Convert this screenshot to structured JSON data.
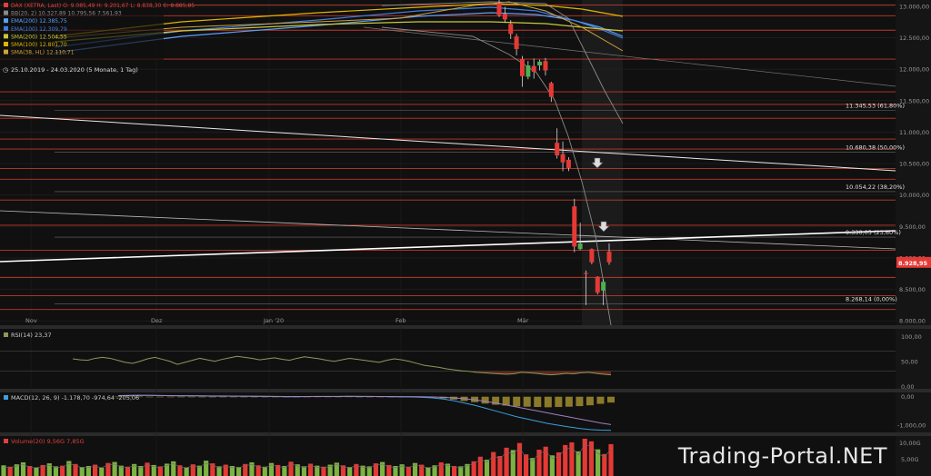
{
  "watermark": "Trading-Portal.NET",
  "main_legend": [
    {
      "text": "DAX (XETRA, Last)  O: 9.085,49  H: 9.201,67  L: 8.838,30  C: 8.885,85",
      "color": "#e04040"
    },
    {
      "text": "BB(20, 2)  10.327,89  10.795,56  7.561,93",
      "color": "#8a8a8a"
    },
    {
      "text": "EMA(200)  12.385,75",
      "color": "#5aa0ff"
    },
    {
      "text": "EMA(100)  12.309,79",
      "color": "#3f7de0"
    },
    {
      "text": "SMA(200)  12.504,55",
      "color": "#c9c93a"
    },
    {
      "text": "SMA(100)  12.801,70",
      "color": "#e0b400"
    },
    {
      "text": "SMA(38, HL)  12.110,71",
      "color": "#d2a23a"
    }
  ],
  "period_label": "25.10.2019 - 24.03.2020  (5 Monate, 1 Tag)",
  "rsi_legend": "RSI(14)  23,37",
  "macd_legend": "MACD(12, 26, 9)  -1.178,70  -974,64  -205,06",
  "volume_legend": "Volume(20)  9,56G  7,85G",
  "current_price_badge": "8.928,95",
  "colors": {
    "up": "#4caf50",
    "down": "#e53935",
    "level_line": "#c0392b",
    "trend_line": "#e8e8e8",
    "bg": "#101010"
  },
  "chart_data": [
    {
      "type": "candlestick",
      "title": "DAX (XETRA, Last)",
      "x_tick_labels": [
        "Nov",
        "Dez",
        "Jan '20",
        "Feb",
        "Mär"
      ],
      "y_tick_labels": [
        "13.000,00",
        "12.500,00",
        "12.000,00",
        "11.500,00",
        "11.000,00",
        "10.500,00",
        "10.000,00",
        "9.500,00",
        "9.000,00",
        "8.500,00",
        "8.000,00"
      ],
      "ylim": [
        7930,
        13100
      ],
      "fibonacci": [
        {
          "value": 11345.53,
          "label": "11.345,53 (61,80%)"
        },
        {
          "value": 10680.38,
          "label": "10.680,38 (50,00%)"
        },
        {
          "value": 10054.22,
          "label": "10.054,22 (38,20%)"
        },
        {
          "value": 9330.05,
          "label": "9.330,05 (23,60%)"
        },
        {
          "value": 8268.14,
          "label": "8.268,14 (0,00%)"
        }
      ],
      "horizontal_levels": [
        13020,
        12850,
        12620,
        12160,
        11640,
        11440,
        11220,
        10890,
        10730,
        10420,
        10250,
        9920,
        9520,
        9120,
        8690,
        8400,
        8180
      ],
      "last_price": 8928.95,
      "candles": [
        {
          "date": "24.02.2020",
          "open": 13050,
          "high": 13150,
          "low": 12830,
          "close": 12860
        },
        {
          "date": "25.02.2020",
          "open": 12880,
          "high": 12990,
          "low": 12740,
          "close": 12790
        },
        {
          "date": "26.02.2020",
          "open": 12720,
          "high": 12780,
          "low": 12480,
          "close": 12560
        },
        {
          "date": "27.02.2020",
          "open": 12520,
          "high": 12560,
          "low": 12220,
          "close": 12320
        },
        {
          "date": "28.02.2020",
          "open": 12160,
          "high": 12210,
          "low": 11720,
          "close": 11890
        },
        {
          "date": "02.03.2020",
          "open": 11880,
          "high": 12130,
          "low": 11840,
          "close": 12060
        },
        {
          "date": "03.03.2020",
          "open": 12050,
          "high": 12170,
          "low": 11850,
          "close": 11960
        },
        {
          "date": "04.03.2020",
          "open": 12060,
          "high": 12150,
          "low": 11980,
          "close": 12120
        },
        {
          "date": "05.03.2020",
          "open": 12130,
          "high": 12180,
          "low": 11900,
          "close": 11980
        },
        {
          "date": "06.03.2020",
          "open": 11780,
          "high": 11800,
          "low": 11480,
          "close": 11560
        },
        {
          "date": "09.03.2020",
          "open": 10830,
          "high": 11060,
          "low": 10580,
          "close": 10630
        },
        {
          "date": "10.03.2020",
          "open": 10650,
          "high": 10850,
          "low": 10380,
          "close": 10520
        },
        {
          "date": "11.03.2020",
          "open": 10560,
          "high": 10600,
          "low": 10380,
          "close": 10430
        },
        {
          "date": "12.03.2020",
          "open": 9820,
          "high": 9940,
          "low": 9090,
          "close": 9180
        },
        {
          "date": "13.03.2020",
          "open": 9140,
          "high": 9560,
          "low": 9120,
          "close": 9230
        },
        {
          "date": "16.03.2020",
          "open": 8760,
          "high": 8800,
          "low": 8250,
          "close": 8750
        },
        {
          "date": "17.03.2020",
          "open": 9140,
          "high": 9150,
          "low": 8900,
          "close": 8930
        },
        {
          "date": "18.03.2020",
          "open": 8700,
          "high": 8710,
          "low": 8420,
          "close": 8450
        },
        {
          "date": "19.03.2020",
          "open": 8480,
          "high": 8660,
          "low": 8250,
          "close": 8620
        },
        {
          "date": "20.03.2020",
          "open": 9100,
          "high": 9230,
          "low": 8890,
          "close": 8930
        }
      ]
    },
    {
      "type": "line",
      "title": "RSI(14)",
      "y_tick_labels": [
        "100,00",
        "50,00",
        "0,00"
      ],
      "ylim": [
        -5,
        115
      ],
      "levels": [
        70,
        30
      ],
      "values": [
        55,
        53,
        52,
        56,
        58,
        56,
        52,
        48,
        46,
        50,
        55,
        58,
        54,
        50,
        44,
        48,
        52,
        56,
        53,
        50,
        54,
        57,
        60,
        58,
        56,
        53,
        55,
        57,
        54,
        52,
        56,
        59,
        57,
        55,
        52,
        50,
        53,
        56,
        54,
        52,
        50,
        48,
        52,
        55,
        53,
        50,
        46,
        42,
        40,
        38,
        35,
        33,
        31,
        30,
        28,
        27,
        26,
        25,
        24,
        25,
        28,
        27,
        26,
        24,
        23,
        24,
        26,
        25,
        27,
        28,
        26,
        24,
        23
      ]
    },
    {
      "type": "line",
      "title": "MACD(12, 26, 9)",
      "y_tick_labels": [
        "0,00",
        "-1.000,00"
      ],
      "ylim": [
        -1250,
        150
      ],
      "macd": [
        40,
        45,
        50,
        45,
        40,
        35,
        30,
        30,
        25,
        20,
        20,
        20,
        15,
        10,
        10,
        5,
        0,
        0,
        5,
        10,
        10,
        10,
        15,
        10,
        5,
        5,
        0,
        -5,
        -10,
        -20,
        -40,
        -80,
        -140,
        -220,
        -300,
        -400,
        -500,
        -600,
        -700,
        -780,
        -860,
        -940,
        -1000,
        -1060,
        -1110,
        -1150,
        -1170,
        -1179
      ],
      "signal": [
        35,
        40,
        45,
        45,
        42,
        38,
        35,
        33,
        30,
        27,
        25,
        22,
        20,
        17,
        14,
        11,
        8,
        6,
        5,
        6,
        7,
        8,
        10,
        10,
        9,
        8,
        6,
        4,
        2,
        -2,
        -8,
        -20,
        -40,
        -70,
        -110,
        -160,
        -220,
        -290,
        -360,
        -430,
        -500,
        -570,
        -640,
        -710,
        -780,
        -850,
        -920,
        -975
      ],
      "histogram": [
        5,
        5,
        5,
        0,
        -2,
        -3,
        -5,
        -3,
        -5,
        -7,
        -5,
        -2,
        -5,
        -7,
        -4,
        -6,
        -8,
        -6,
        0,
        4,
        3,
        2,
        5,
        0,
        -4,
        -3,
        -6,
        -9,
        -12,
        -18,
        -32,
        -60,
        -100,
        -150,
        -190,
        -240,
        -280,
        -310,
        -340,
        -350,
        -360,
        -370,
        -360,
        -350,
        -330,
        -300,
        -250,
        -205
      ]
    },
    {
      "type": "bar",
      "title": "Volume(20)",
      "y_tick_labels": [
        "10,00G",
        "5,00G"
      ],
      "ylim": [
        0,
        12
      ],
      "values": [
        3.2,
        2.8,
        3.5,
        4.1,
        3.0,
        2.6,
        3.3,
        3.8,
        2.9,
        3.1,
        4.5,
        3.6,
        2.7,
        3.0,
        3.4,
        2.5,
        3.9,
        4.2,
        3.1,
        2.8,
        3.6,
        3.0,
        4.0,
        3.3,
        2.9,
        3.7,
        4.4,
        3.2,
        2.6,
        3.5,
        3.1,
        4.6,
        3.8,
        2.9,
        3.4,
        3.0,
        2.7,
        3.6,
        4.1,
        3.2,
        2.8,
        3.9,
        3.3,
        3.0,
        4.3,
        3.5,
        2.9,
        3.7,
        3.1,
        2.8,
        3.4,
        4.0,
        3.2,
        2.7,
        3.6,
        3.1,
        2.9,
        3.8,
        4.2,
        3.3,
        3.0,
        3.5,
        2.8,
        3.9,
        3.4,
        2.6,
        3.2,
        4.1,
        3.7,
        3.0,
        2.9,
        3.6,
        4.4,
        5.8,
        4.9,
        7.2,
        6.0,
        8.5,
        7.8,
        9.9,
        6.5,
        5.4,
        7.9,
        8.8,
        6.2,
        7.1,
        9.3,
        10.1,
        7.4,
        11.2,
        10.4,
        8.0,
        6.6,
        9.56
      ],
      "up": [
        1,
        0,
        1,
        1,
        0,
        1,
        0,
        1,
        1,
        0,
        1,
        0,
        1,
        1,
        0,
        1,
        0,
        1,
        1,
        0,
        1,
        1,
        0,
        1,
        0,
        1,
        1,
        0,
        1,
        0,
        1,
        1,
        0,
        1,
        0,
        1,
        1,
        0,
        1,
        0,
        1,
        1,
        0,
        1,
        0,
        1,
        1,
        0,
        1,
        0,
        1,
        1,
        0,
        1,
        0,
        1,
        1,
        0,
        1,
        0,
        1,
        1,
        0,
        1,
        0,
        1,
        1,
        0,
        1,
        0,
        1,
        1,
        0,
        0,
        1,
        0,
        0,
        0,
        1,
        0,
        0,
        1,
        0,
        0,
        1,
        0,
        0,
        0,
        1,
        0,
        0,
        1,
        0
      ]
    }
  ]
}
